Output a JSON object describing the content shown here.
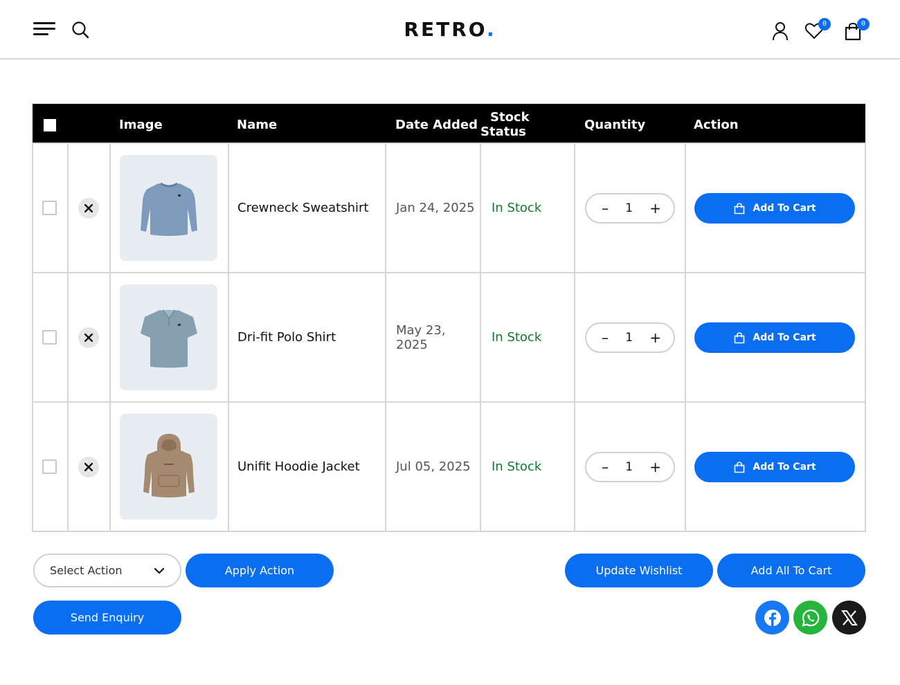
{
  "header": {
    "logo_text": "RETRO",
    "logo_dot": ".",
    "wishlist_count": "0",
    "cart_count": "0",
    "icons": [
      "menu-icon",
      "search-icon",
      "user-icon",
      "heart-icon",
      "bag-icon"
    ]
  },
  "table": {
    "columns": [
      "",
      "",
      "Image",
      "Name",
      "Date Added",
      "Stock Status",
      "Quantity",
      "Action"
    ],
    "rows": [
      {
        "name": "Crewneck Sweatshirt",
        "date": "Jan 24, 2025",
        "stock": "In Stock",
        "qty": "1",
        "action": "Add To Cart",
        "image": "sweatshirt-image"
      },
      {
        "name": "Dri-fit Polo Shirt",
        "date": "May 23, 2025",
        "stock": "In Stock",
        "qty": "1",
        "action": "Add To Cart",
        "image": "polo-shirt-image"
      },
      {
        "name": "Unifit Hoodie Jacket",
        "date": "Jul 05, 2025",
        "stock": "In Stock",
        "qty": "1",
        "action": "Add To Cart",
        "image": "hoodie-image"
      }
    ],
    "qty_minus": "–",
    "qty_plus": "+"
  },
  "actions": {
    "select_placeholder": "Select Action",
    "apply": "Apply Action",
    "update_wishlist": "Update Wishlist",
    "add_all": "Add All To Cart",
    "send_enquiry": "Send Enquiry"
  },
  "social": [
    "facebook-icon",
    "whatsapp-icon",
    "x-icon"
  ],
  "colors": {
    "accent": "#0a6ef2",
    "in_stock": "#0f7a2c",
    "header_bg": "#000000",
    "thumb_bg": "#e8edf3",
    "facebook": "#1877f2",
    "whatsapp": "#25b43c",
    "x": "#1a1a1a"
  }
}
